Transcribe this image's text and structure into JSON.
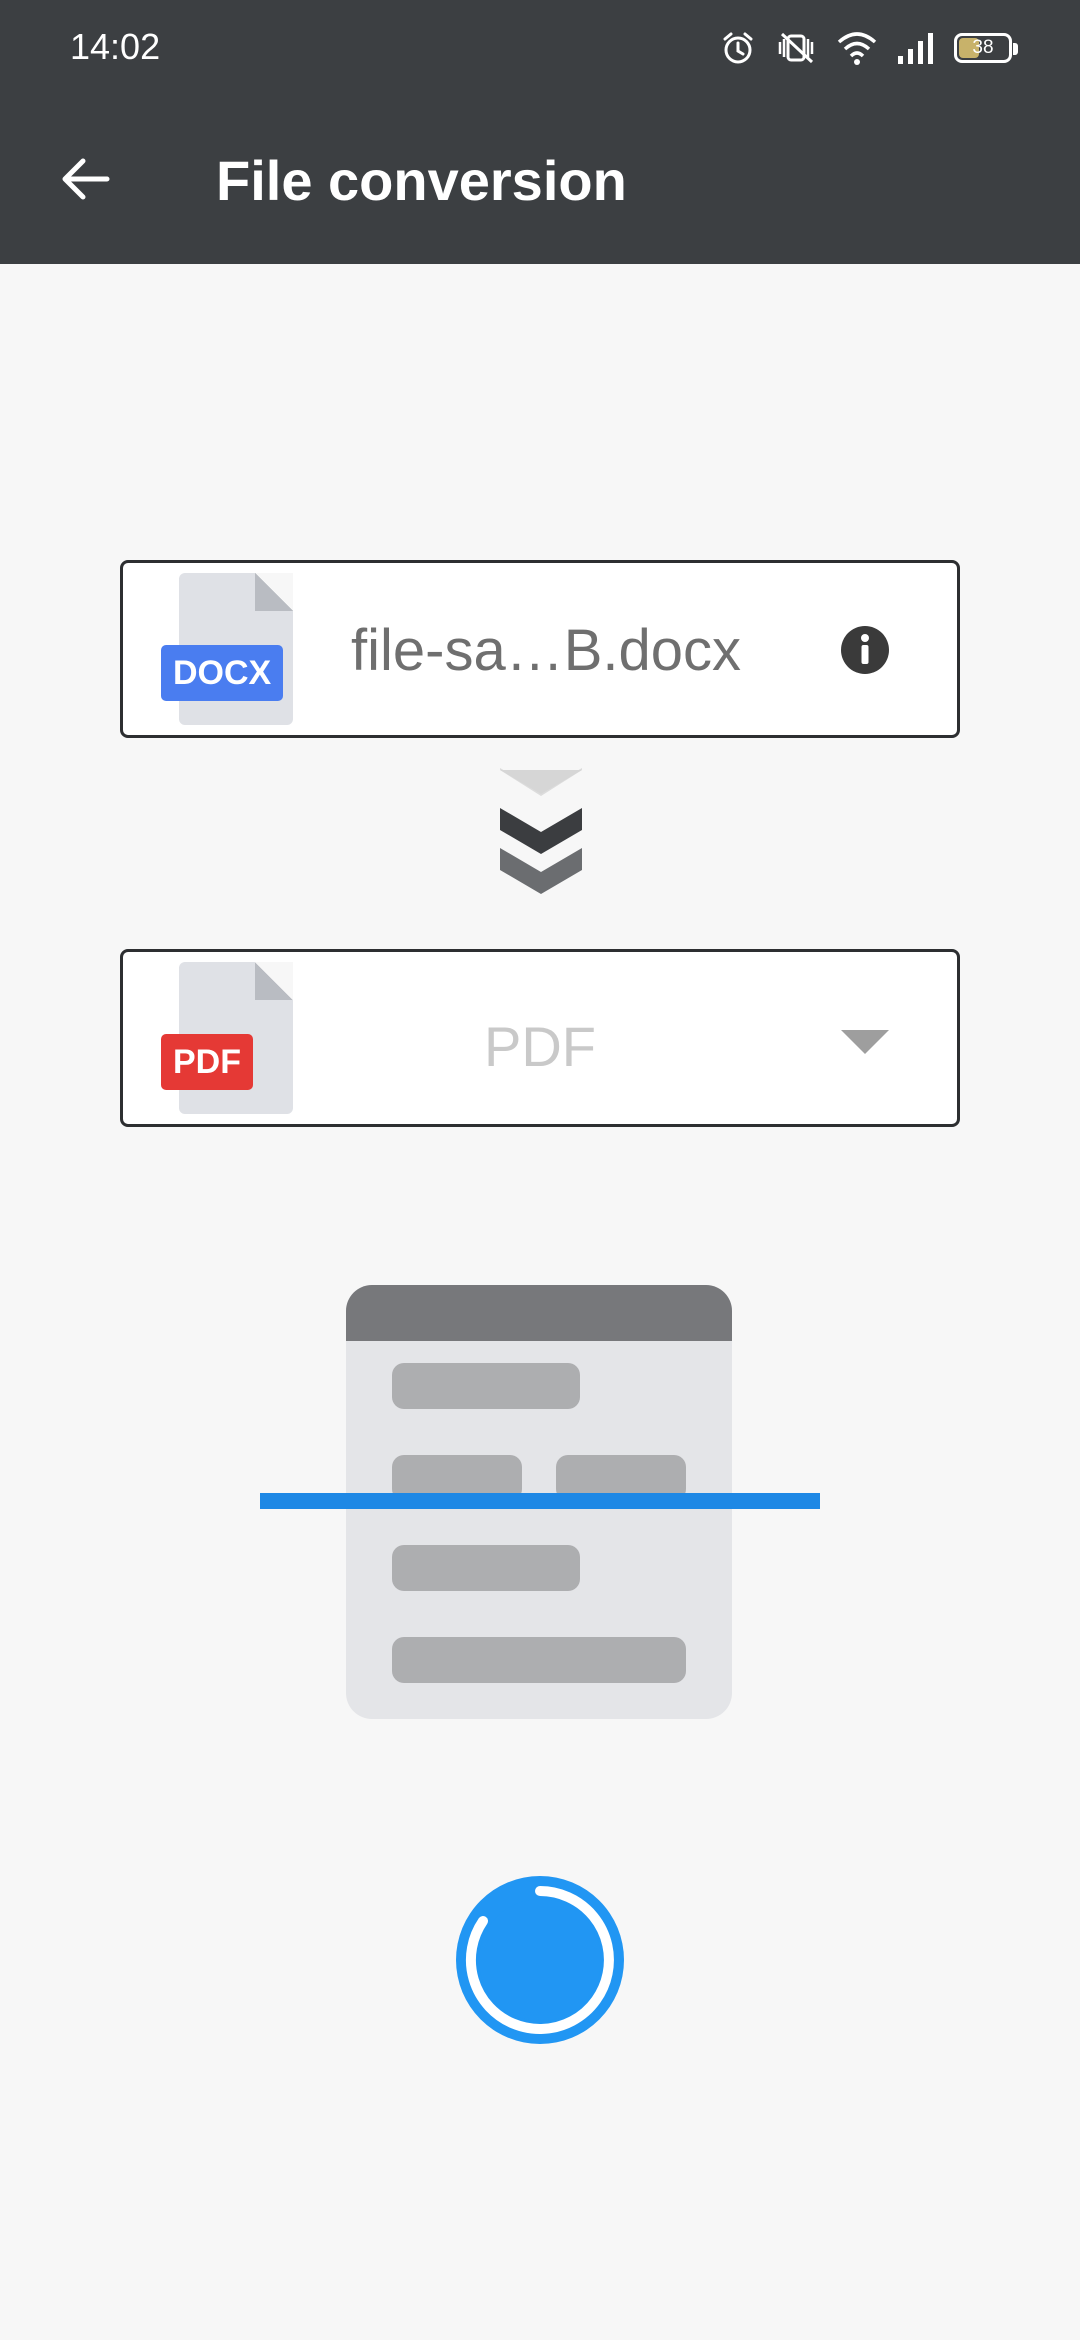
{
  "status_bar": {
    "time": "14:02",
    "battery_level": "38"
  },
  "app_bar": {
    "back_icon": "arrow-left-icon",
    "title": "File conversion"
  },
  "source_file": {
    "badge": "DOCX",
    "badge_color": "#4a7df0",
    "name": "file-sa…B.docx",
    "info_icon": "info-icon"
  },
  "target_format": {
    "badge": "PDF",
    "badge_color": "#e53935",
    "selected": "PDF",
    "dropdown_icon": "caret-down-icon"
  },
  "colors": {
    "toolbar": "#3c3f42",
    "accent": "#2196f3",
    "background": "#f7f7f7"
  },
  "progress": {
    "state": "converting",
    "icon": "loading-spinner-icon"
  }
}
